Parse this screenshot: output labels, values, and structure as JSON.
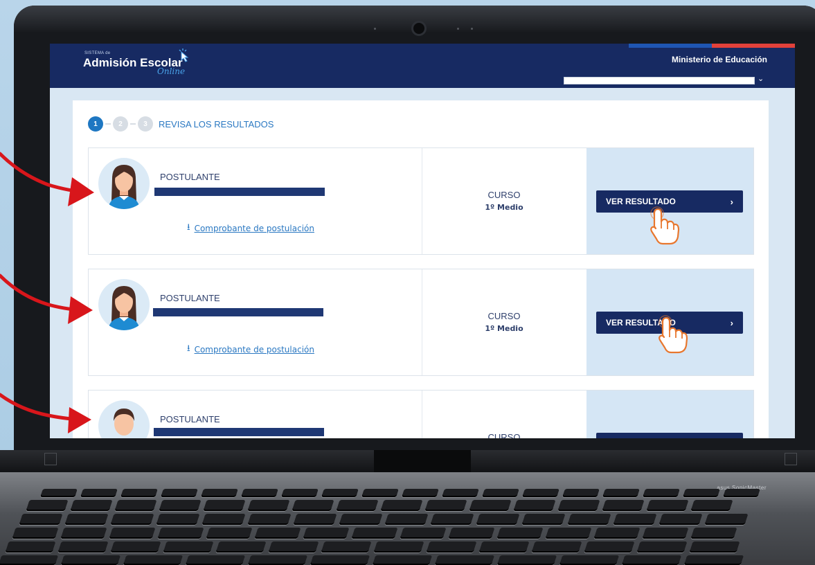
{
  "header": {
    "logo_small": "SISTEMA de",
    "logo_main": "Admisión Escolar",
    "logo_online": "Online",
    "ministry": "Ministerio de Educación"
  },
  "steps": {
    "items": [
      "1",
      "2",
      "3"
    ],
    "active": 1,
    "title": "REVISA LOS RESULTADOS"
  },
  "applicants": [
    {
      "label": "POSTULANTE",
      "avatar": "girl-avatar",
      "download_link": "Comprobante de postulación",
      "course_label": "CURSO",
      "course_value": "1º Medio",
      "button_label": "VER RESULTADO"
    },
    {
      "label": "POSTULANTE",
      "avatar": "girl-avatar",
      "download_link": "Comprobante de postulación",
      "course_label": "CURSO",
      "course_value": "1º Medio",
      "button_label": "VER RESULTADO"
    },
    {
      "label": "POSTULANTE",
      "avatar": "boy-avatar",
      "course_label": "CURSO"
    }
  ],
  "laptop": {
    "brand": "asus SonicMaster"
  },
  "colors": {
    "primary": "#172a62",
    "accent": "#2a78c2",
    "action_bg": "#d5e6f5",
    "arrow": "#d8161b",
    "hand": "#e8772e"
  }
}
